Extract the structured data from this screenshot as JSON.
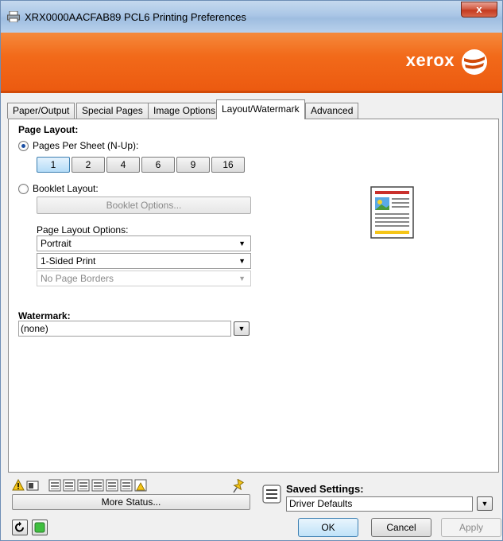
{
  "window": {
    "title": "XRX0000AACFAB89 PCL6 Printing Preferences",
    "close_label": "x"
  },
  "banner": {
    "logo": "xerox"
  },
  "tabs": [
    {
      "label": "Paper/Output"
    },
    {
      "label": "Special Pages"
    },
    {
      "label": "Image Options"
    },
    {
      "label": "Layout/Watermark"
    },
    {
      "label": "Advanced"
    }
  ],
  "active_tab": "Layout/Watermark",
  "page_layout": {
    "title": "Page Layout:",
    "pages_per_sheet_label": "Pages Per Sheet (N-Up):",
    "pages_per_sheet_selected": true,
    "nup_options": [
      "1",
      "2",
      "4",
      "6",
      "9",
      "16"
    ],
    "nup_selected": "1",
    "booklet_label": "Booklet Layout:",
    "booklet_selected": false,
    "booklet_options_button": "Booklet Options...",
    "options_label": "Page Layout Options:",
    "orientation": "Portrait",
    "sides": "1-Sided Print",
    "borders": "No Page Borders"
  },
  "watermark": {
    "title": "Watermark:",
    "value": "(none)"
  },
  "bottom": {
    "more_status": "More Status...",
    "saved_settings_label": "Saved Settings:",
    "saved_settings_value": "Driver Defaults",
    "ok": "OK",
    "cancel": "Cancel",
    "apply": "Apply"
  },
  "colors": {
    "banner_orange": "#f26a1a",
    "selection_blue": "#b4dcf7"
  }
}
